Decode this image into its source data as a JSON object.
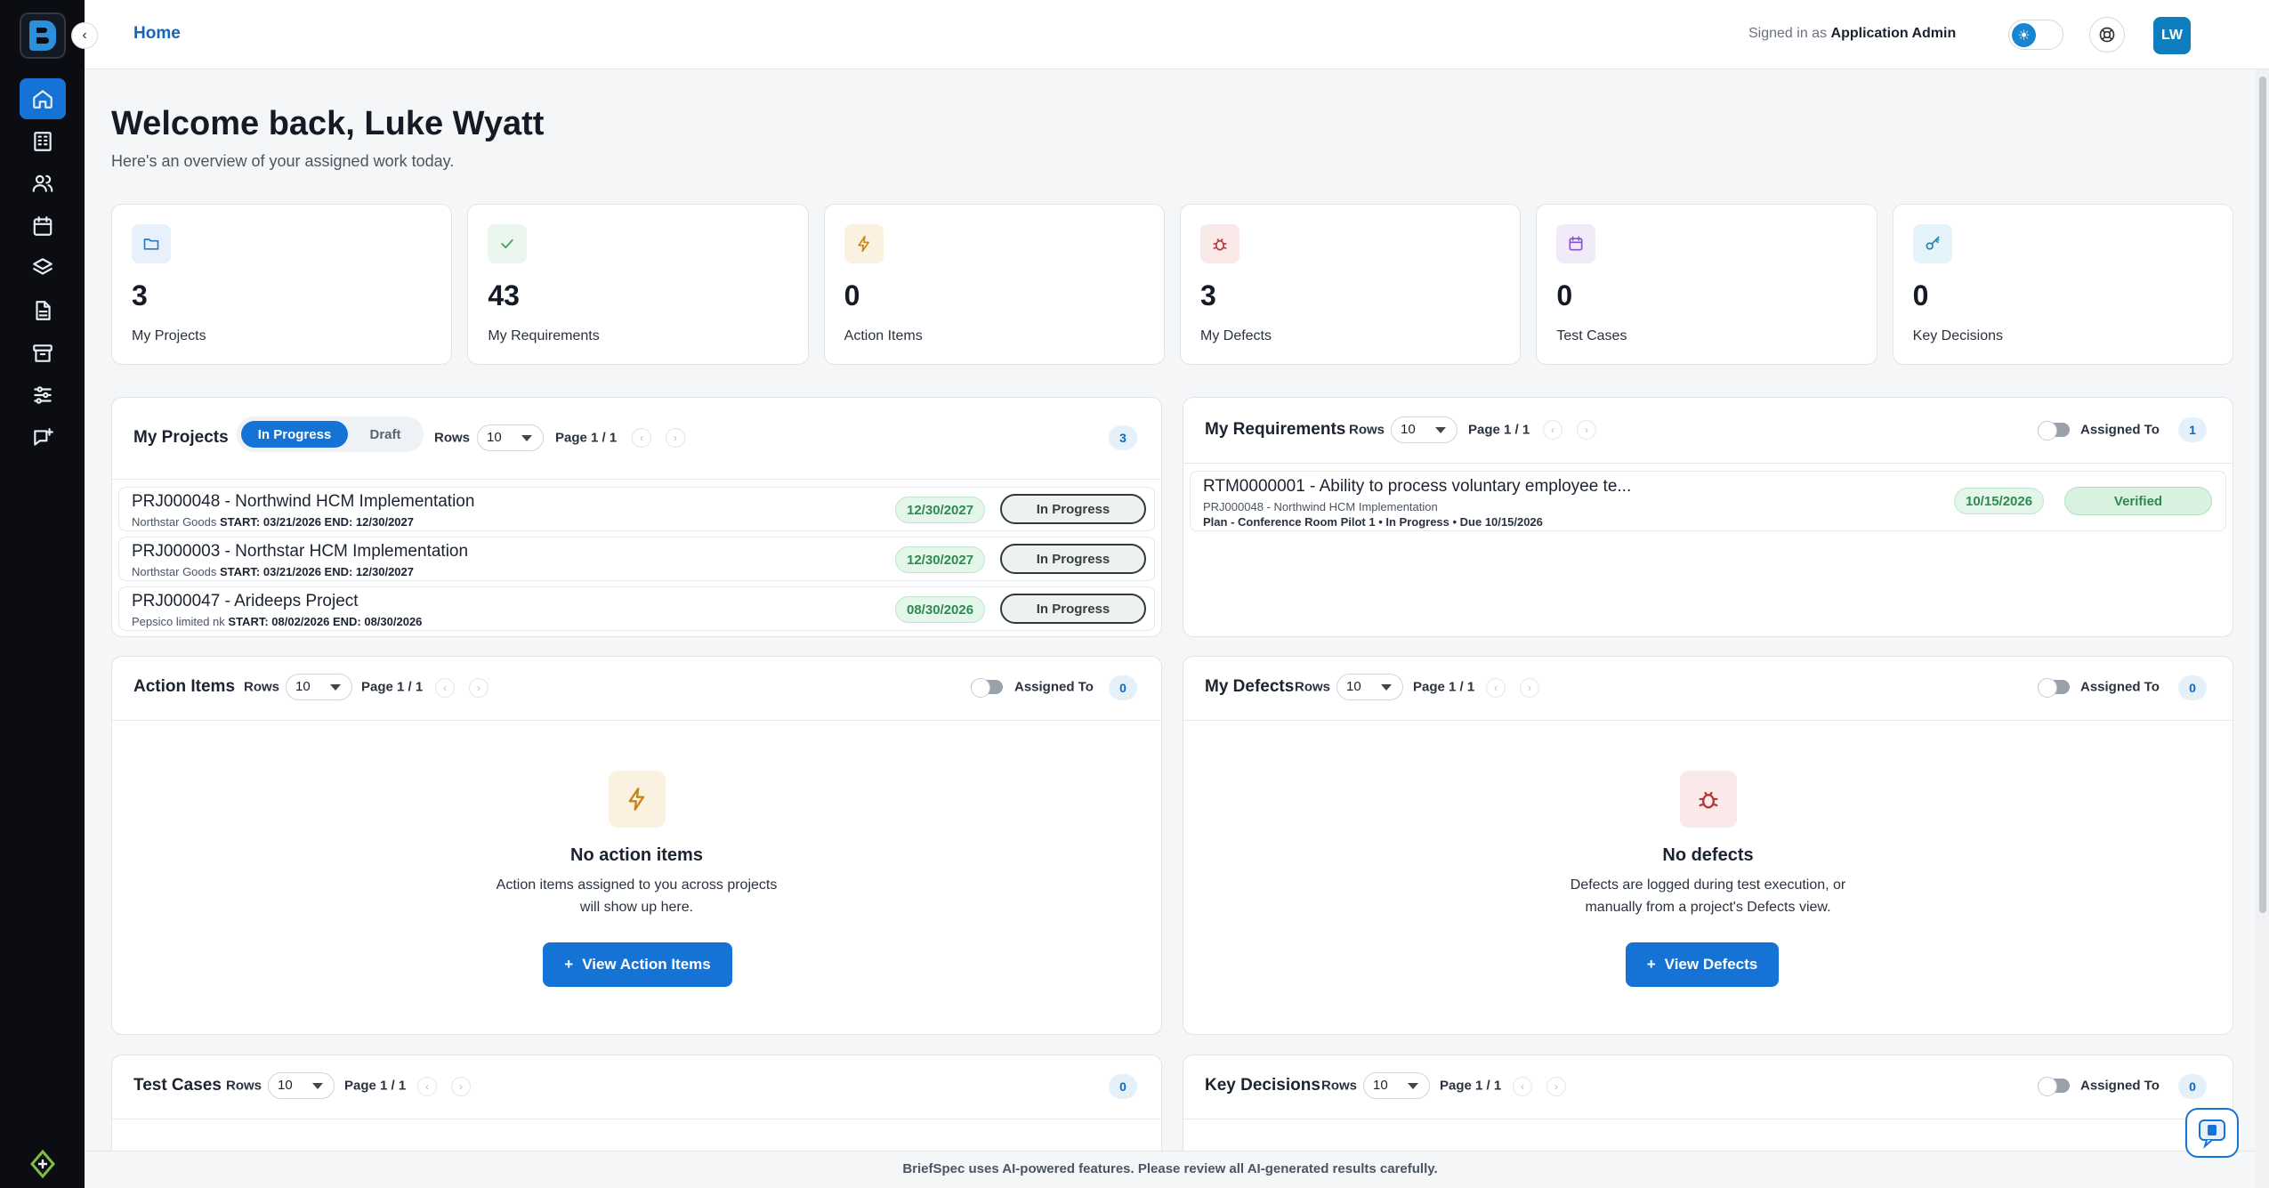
{
  "topbar": {
    "breadcrumb": "Home",
    "signed_in_prefix": "Signed in as",
    "signed_in_role": "Application Admin",
    "avatar_initials": "LW"
  },
  "welcome": {
    "title": "Welcome back, Luke Wyatt",
    "subtitle": "Here's an overview of your assigned work today."
  },
  "stats": [
    {
      "value": "3",
      "label": "My Projects",
      "icon": "folder-icon",
      "color": "#2b78c5",
      "bg": "#e8f1fb"
    },
    {
      "value": "43",
      "label": "My Requirements",
      "icon": "check-icon",
      "color": "#3a9a5d",
      "bg": "#eaf6ee"
    },
    {
      "value": "0",
      "label": "Action Items",
      "icon": "bolt-icon",
      "color": "#c98512",
      "bg": "#fbf1e1"
    },
    {
      "value": "3",
      "label": "My Defects",
      "icon": "bug-icon",
      "color": "#b23b3b",
      "bg": "#f9e9e9"
    },
    {
      "value": "0",
      "label": "Test Cases",
      "icon": "calendar-icon",
      "color": "#8a55c9",
      "bg": "#f1eaf9"
    },
    {
      "value": "0",
      "label": "Key Decisions",
      "icon": "key-icon",
      "color": "#1b87b8",
      "bg": "#e5f3fa"
    }
  ],
  "my_projects": {
    "title": "My Projects",
    "tab_active": "In Progress",
    "tab_inactive": "Draft",
    "rows_label": "Rows",
    "rows_value": "10",
    "page": "Page 1 / 1",
    "count": "3",
    "items": [
      {
        "name": "PRJ000048 - Northwind HCM Implementation",
        "client": "Northstar Goods",
        "dates": "START: 03/21/2026 END: 12/30/2027",
        "due": "12/30/2027",
        "status": "In Progress"
      },
      {
        "name": "PRJ000003 - Northstar HCM Implementation",
        "client": "Northstar Goods",
        "dates": "START: 03/21/2026 END: 12/30/2027",
        "due": "12/30/2027",
        "status": "In Progress"
      },
      {
        "name": "PRJ000047 - Arideeps Project",
        "client": "Pepsico limited nk",
        "dates": "START: 08/02/2026 END: 08/30/2026",
        "due": "08/30/2026",
        "status": "In Progress"
      }
    ]
  },
  "my_requirements": {
    "title": "My Requirements",
    "rows_label": "Rows",
    "rows_value": "10",
    "page": "Page 1 / 1",
    "assigned_label": "Assigned To",
    "count": "1",
    "items": [
      {
        "name": "RTM0000001 - Ability to process voluntary employee te...",
        "project": "PRJ000048 - Northwind HCM Implementation",
        "meta": "Plan - Conference Room Pilot 1 • In Progress • Due 10/15/2026",
        "due": "10/15/2026",
        "status": "Verified"
      }
    ]
  },
  "action_items": {
    "title": "Action Items",
    "rows_label": "Rows",
    "rows_value": "10",
    "page": "Page 1 / 1",
    "assigned_label": "Assigned To",
    "count": "0",
    "empty_title": "No action items",
    "empty_line1": "Action items assigned to you across projects",
    "empty_line2": "will show up here.",
    "button": "View Action Items"
  },
  "my_defects": {
    "title": "My Defects",
    "rows_label": "Rows",
    "rows_value": "10",
    "page": "Page 1 / 1",
    "assigned_label": "Assigned To",
    "count": "0",
    "empty_title": "No defects",
    "empty_line1": "Defects are logged during test execution, or",
    "empty_line2": "manually from a project's Defects view.",
    "button": "View Defects"
  },
  "test_cases": {
    "title": "Test Cases",
    "rows_label": "Rows",
    "rows_value": "10",
    "page": "Page 1 / 1",
    "count": "0"
  },
  "key_decisions": {
    "title": "Key Decisions",
    "rows_label": "Rows",
    "rows_value": "10",
    "page": "Page 1 / 1",
    "assigned_label": "Assigned To",
    "count": "0"
  },
  "footer": "BriefSpec uses AI-powered features. Please review all AI-generated results carefully.",
  "colors": {
    "accent": "#1673d6",
    "sidebar": "#0b0d12",
    "success": "#2d8a50"
  }
}
